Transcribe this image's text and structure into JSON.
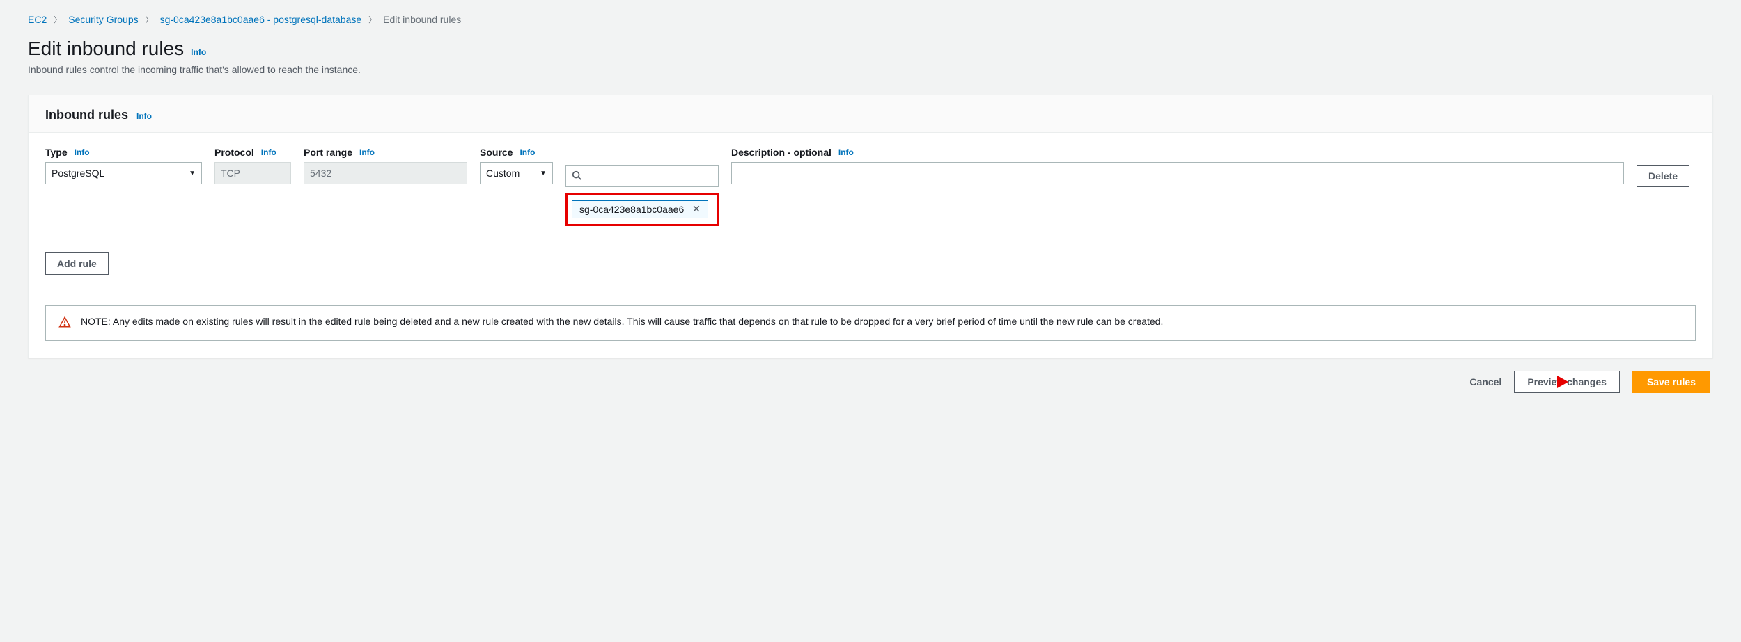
{
  "breadcrumb": {
    "items": [
      "EC2",
      "Security Groups",
      "sg-0ca423e8a1bc0aae6 - postgresql-database"
    ],
    "current": "Edit inbound rules"
  },
  "page": {
    "title": "Edit inbound rules",
    "info": "Info",
    "description": "Inbound rules control the incoming traffic that's allowed to reach the instance."
  },
  "panel": {
    "title": "Inbound rules",
    "info": "Info"
  },
  "columns": {
    "type": "Type",
    "protocol": "Protocol",
    "port": "Port range",
    "source": "Source",
    "description": "Description - optional",
    "info": "Info"
  },
  "rule": {
    "type": "PostgreSQL",
    "protocol": "TCP",
    "port": "5432",
    "source_mode": "Custom",
    "source_tag": "sg-0ca423e8a1bc0aae6",
    "description": ""
  },
  "buttons": {
    "delete": "Delete",
    "add_rule": "Add rule",
    "cancel": "Cancel",
    "preview": "Preview changes",
    "save": "Save rules"
  },
  "note": "NOTE: Any edits made on existing rules will result in the edited rule being deleted and a new rule created with the new details. This will cause traffic that depends on that rule to be dropped for a very brief period of time until the new rule can be created."
}
